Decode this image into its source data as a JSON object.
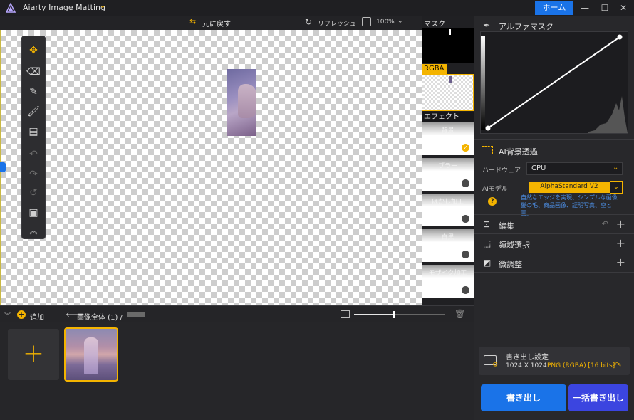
{
  "app": {
    "title": "Aiarty Image Matting",
    "home_button": "ホーム",
    "window_controls": {
      "minimize": "—",
      "maximize": "☐",
      "close": "✕"
    }
  },
  "canvas_toolbar": {
    "undo_label": "元に戻す",
    "refresh_label": "リフレッシュ",
    "zoom": "100%"
  },
  "tools": [
    {
      "icon": "move-icon",
      "active": true
    },
    {
      "icon": "eraser-icon",
      "active": true
    },
    {
      "icon": "pen-icon",
      "active": true
    },
    {
      "icon": "brush-icon",
      "active": true
    },
    {
      "icon": "roller-icon",
      "active": true
    },
    {
      "icon": "undo-icon",
      "active": false
    },
    {
      "icon": "redo-icon",
      "active": false
    },
    {
      "icon": "reset-icon",
      "active": false
    },
    {
      "icon": "compare-icon",
      "active": true
    },
    {
      "icon": "collapse-up-icon",
      "active": true
    }
  ],
  "preview": {
    "mask_label": "マスク",
    "rgba_label": "RGBA",
    "effect_label": "エフェクト",
    "effects": [
      {
        "name": "背景",
        "selected": true
      },
      {
        "name": "ブラー",
        "selected": false
      },
      {
        "name": "ほかし加工",
        "selected": false
      },
      {
        "name": "白黒",
        "selected": false
      },
      {
        "name": "モザイク加工",
        "selected": false
      }
    ]
  },
  "bottom": {
    "add_label": "追加",
    "breadcrumb": "画像全体 (1) /",
    "add_tile_symbol": "+"
  },
  "right_panel": {
    "alpha_mask_title": "アルファマスク",
    "ai_section": {
      "title": "AI背景透過",
      "hardware_label": "ハードウェア",
      "hardware_value": "CPU",
      "model_label": "AIモデル",
      "model_value": "AlphaStandard  V2",
      "model_description": "自然なエッジを実現、シンプルな画像 髪の毛、商品画像、証明写真、空と雲。"
    },
    "sections": [
      {
        "label": "編集",
        "icon": "crop-icon"
      },
      {
        "label": "領域選択",
        "icon": "selection-icon"
      },
      {
        "label": "微調整",
        "icon": "adjust-icon"
      }
    ],
    "export": {
      "title": "書き出し設定",
      "size": "1024 X 1024",
      "format": "PNG (RGBA) [16 bits]",
      "export_button": "書き出し",
      "batch_button": "一括書き出し"
    }
  },
  "colors": {
    "accent": "#f4b400",
    "primary_blue": "#1a73e8",
    "batch_blue": "#3b45e0",
    "panel_bg": "#28282b"
  }
}
